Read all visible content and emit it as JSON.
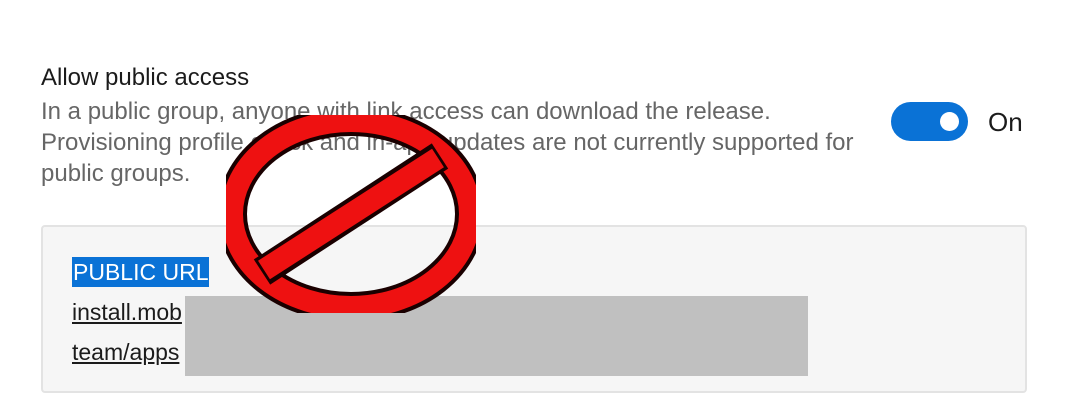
{
  "setting": {
    "title": "Allow public access",
    "description": "In a public group, anyone with link access can download the release. Provisioning profile check and in-app updates are not currently supported for public groups.",
    "toggle": {
      "state_label": "On",
      "checked": true,
      "color": "#0a72d6"
    }
  },
  "public_url": {
    "label": "PUBLIC URL",
    "line1": "install.mob",
    "line2": "team/apps"
  },
  "overlay": {
    "icon": "prohibited-sign-icon",
    "color": "#ee1111"
  }
}
